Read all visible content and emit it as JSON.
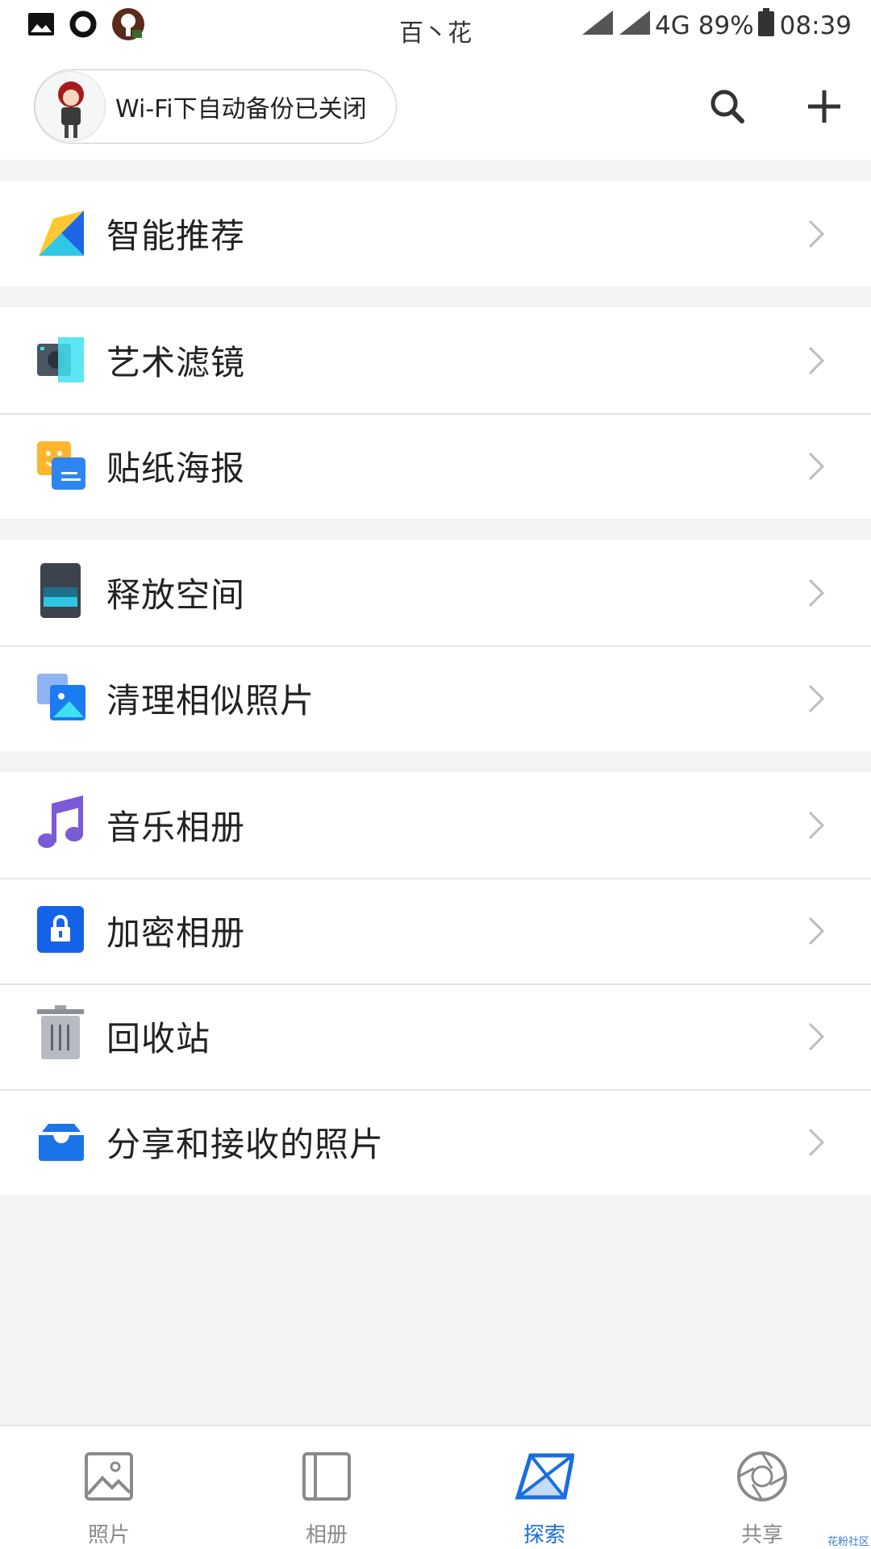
{
  "status_bar": {
    "carrier": "百丶花",
    "network": "4G",
    "battery": "89%",
    "time": "08:39",
    "icons": [
      "image-icon",
      "circle-icon",
      "app-icon",
      "signal-icon",
      "signal-icon",
      "battery-icon"
    ]
  },
  "header": {
    "backup_status": "Wi-Fi下自动备份已关闭",
    "avatar": "avatar",
    "search_icon": "search-icon",
    "add_icon": "add-icon"
  },
  "groups": [
    {
      "items": [
        {
          "label": "智能推荐",
          "icon": "smart-recommend-icon"
        }
      ]
    },
    {
      "items": [
        {
          "label": "艺术滤镜",
          "icon": "art-filter-icon"
        },
        {
          "label": "贴纸海报",
          "icon": "sticker-poster-icon"
        }
      ]
    },
    {
      "items": [
        {
          "label": "释放空间",
          "icon": "free-space-icon"
        },
        {
          "label": "清理相似照片",
          "icon": "clean-similar-photos-icon"
        }
      ]
    },
    {
      "items": [
        {
          "label": "音乐相册",
          "icon": "music-album-icon"
        },
        {
          "label": "加密相册",
          "icon": "encrypted-album-icon"
        },
        {
          "label": "回收站",
          "icon": "recycle-bin-icon"
        },
        {
          "label": "分享和接收的照片",
          "icon": "shared-photos-icon"
        }
      ]
    }
  ],
  "tabs": [
    {
      "label": "照片",
      "icon": "photos-icon",
      "active": false
    },
    {
      "label": "相册",
      "icon": "albums-icon",
      "active": false
    },
    {
      "label": "探索",
      "icon": "discover-icon",
      "active": true
    },
    {
      "label": "共享",
      "icon": "sharing-icon",
      "active": false
    }
  ],
  "colors": {
    "accent": "#1a6fe0",
    "background": "#f3f3f4",
    "tab_inactive": "#8a8a8a"
  },
  "watermark": "花粉社区"
}
